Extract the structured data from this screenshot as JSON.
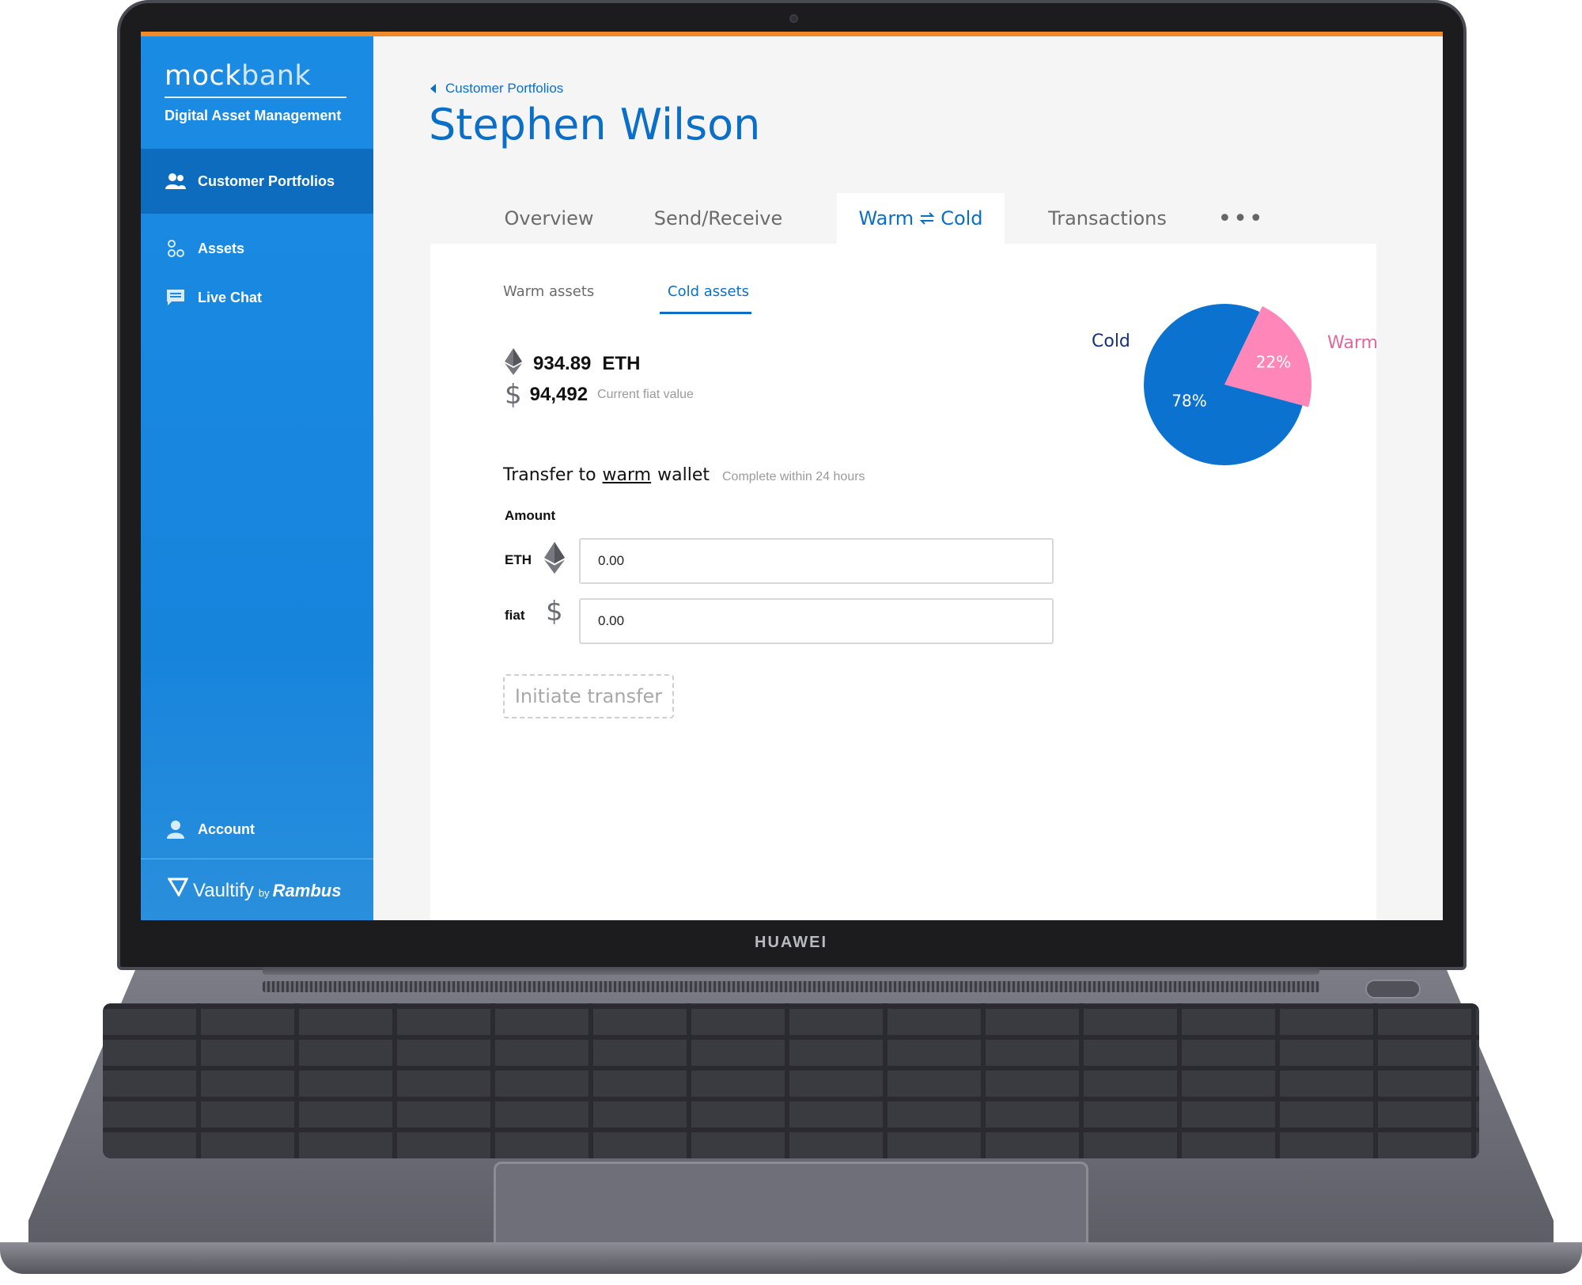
{
  "app": {
    "brand_part1": "mock",
    "brand_part2": "bank",
    "subtitle": "Digital Asset Management"
  },
  "sidebar": {
    "items": [
      {
        "label": "Customer Portfolios",
        "icon": "users-icon",
        "active": true
      },
      {
        "label": "Assets",
        "icon": "assets-icon",
        "active": false
      },
      {
        "label": "Live Chat",
        "icon": "chat-icon",
        "active": false
      }
    ],
    "account_label": "Account",
    "footer": {
      "vaultify": "Vaultify",
      "by": "by",
      "rambus": "Rambus"
    }
  },
  "breadcrumb": "Customer Portfolios",
  "page_title": "Stephen Wilson",
  "tabs": {
    "overview": "Overview",
    "send_receive": "Send/Receive",
    "warm_cold_left": "Warm",
    "warm_cold_right": "Cold",
    "transactions": "Transactions",
    "more": "•••"
  },
  "subtabs": {
    "warm": "Warm assets",
    "cold": "Cold assets",
    "active": "cold"
  },
  "balance": {
    "eth_value": "934.89",
    "eth_unit": "ETH",
    "fiat_value": "94,492",
    "fiat_note": "Current fiat value"
  },
  "transfer": {
    "prefix": "Transfer to",
    "target": "warm",
    "suffix": "wallet",
    "note": "Complete within 24 hours",
    "amount_label": "Amount",
    "eth_label": "ETH",
    "eth_value": "0.00",
    "fiat_label": "fiat",
    "fiat_value": "0.00",
    "button": "Initiate transfer"
  },
  "chart_data": {
    "type": "pie",
    "slices": [
      {
        "label": "Cold",
        "value": 78,
        "display": "78%",
        "color": "#0b72d0"
      },
      {
        "label": "Warm",
        "value": 22,
        "display": "22%",
        "color": "#ff86b8"
      }
    ]
  },
  "colors": {
    "accent": "#0b6fc8",
    "sidebar": "#1a8be3",
    "warm": "#ff86b8",
    "cold": "#0b72d0"
  },
  "device": {
    "brand": "HUAWEI"
  }
}
